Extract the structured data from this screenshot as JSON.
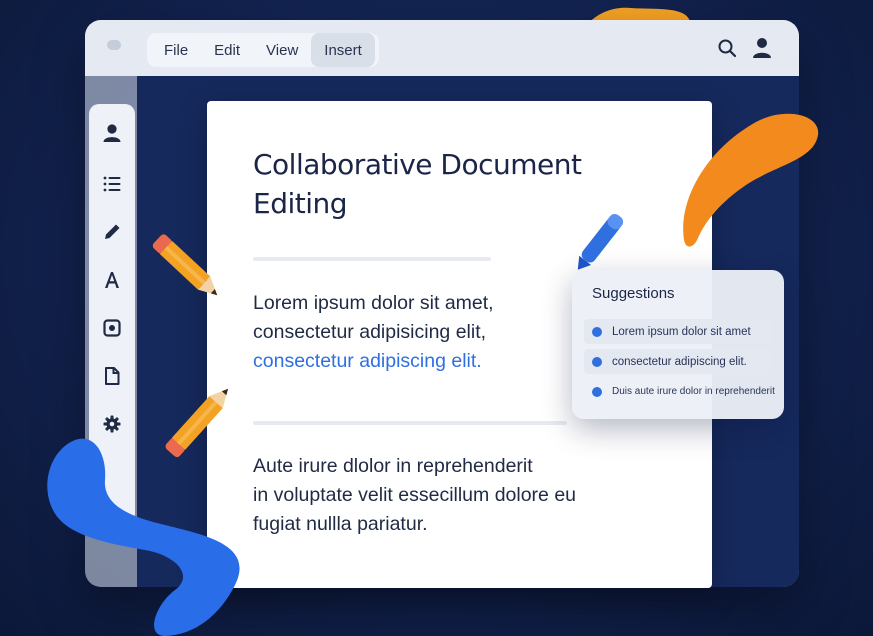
{
  "menu": {
    "items": [
      {
        "label": "File"
      },
      {
        "label": "Edit"
      },
      {
        "label": "View"
      },
      {
        "label": "Insert"
      }
    ]
  },
  "toolbar": {
    "right_icons": [
      "search-icon",
      "user-icon"
    ]
  },
  "sidebar": {
    "icons": [
      "user-icon",
      "list-icon",
      "pen-icon",
      "text-format-icon",
      "image-icon",
      "document-icon",
      "gear-icon"
    ]
  },
  "document": {
    "title": "Collaborative Document Editing",
    "paragraph1": {
      "line1": "Lorem ipsum dolor sit amet,",
      "line2": "consectetur adipisicing elit,",
      "line3": "consectetur adipiscing elit."
    },
    "paragraph2": {
      "line1": "Aute irure dlolor in reprehenderit",
      "line2": "in voluptate velit essecillum dolore eu",
      "line3": "fugiat nullla pariatur."
    }
  },
  "suggestions": {
    "title": "Suggestions",
    "items": [
      {
        "text": "Lorem ipsum dolor sit amet"
      },
      {
        "text": "consectetur adipiscing elit."
      },
      {
        "text": "Duis aute irure dolor in reprehenderit"
      }
    ]
  },
  "colors": {
    "accent_blue": "#2f6fe0",
    "accent_orange": "#f28a1e",
    "background": "#12224f"
  }
}
